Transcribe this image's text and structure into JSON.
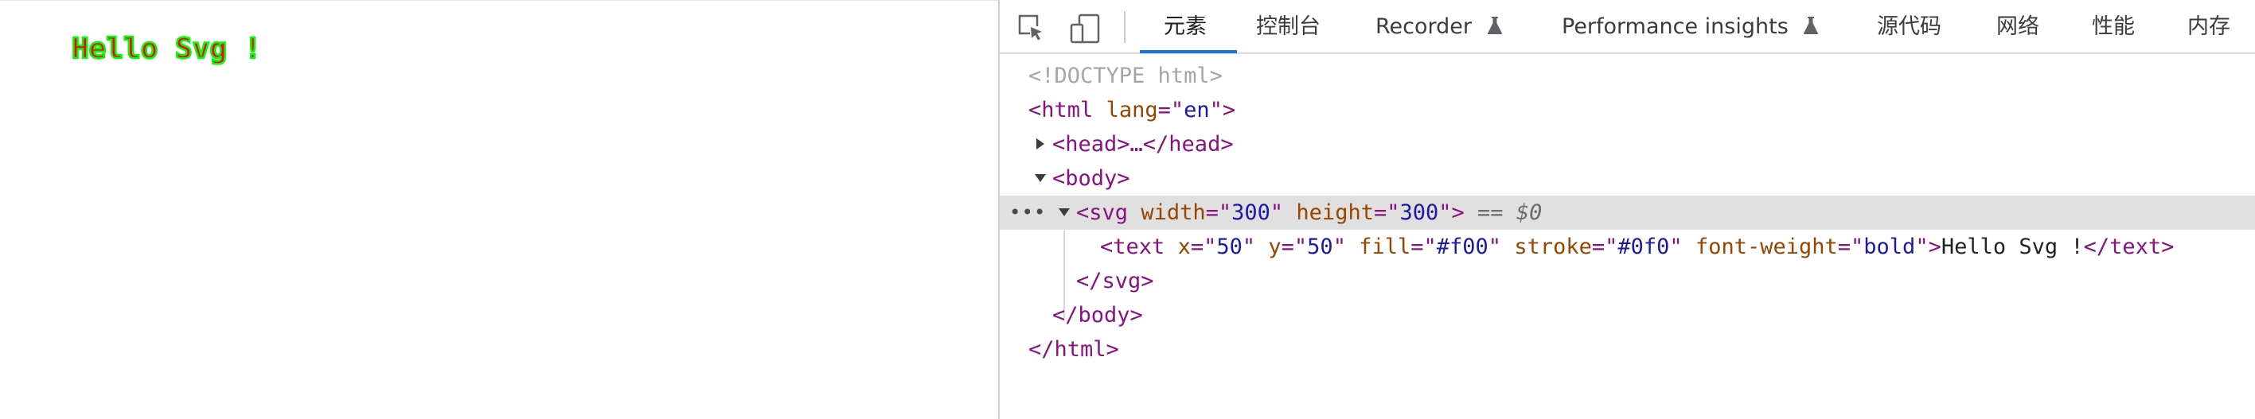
{
  "viewport": {
    "svg_text": "Hello Svg !",
    "svg_fill": "#f00",
    "svg_stroke": "#0f0"
  },
  "toolbar": {
    "inspect_icon": "cursor-select-icon",
    "device_icon": "device-toggle-icon",
    "tabs": [
      {
        "label": "元素",
        "active": true
      },
      {
        "label": "控制台"
      },
      {
        "label": "Recorder",
        "experimental": true
      },
      {
        "label": "Performance insights",
        "experimental": true
      },
      {
        "label": "源代码"
      },
      {
        "label": "网络"
      },
      {
        "label": "性能"
      },
      {
        "label": "内存"
      }
    ],
    "accent_color": "#1a73e8"
  },
  "dom_tree": {
    "doctype": "<!DOCTYPE html>",
    "html_open": {
      "tag": "html",
      "attr": "lang",
      "val": "en"
    },
    "head": "<head>…</head>",
    "body_open": "<body>",
    "svg": {
      "tag": "svg",
      "attr1": "width",
      "val1": "300",
      "attr2": "height",
      "val2": "300",
      "marker": "== $0"
    },
    "text_el": {
      "tag": "text",
      "attr_x": "x",
      "val_x": "50",
      "attr_y": "y",
      "val_y": "50",
      "attr_fill": "fill",
      "val_fill": "#f00",
      "attr_stroke": "stroke",
      "val_stroke": "#0f0",
      "attr_fw": "font-weight",
      "val_fw": "bold",
      "content": "Hello Svg !",
      "close": "</text>"
    },
    "svg_close": "</svg>",
    "body_close": "</body>",
    "html_close": "</html>",
    "dots": "•••"
  }
}
